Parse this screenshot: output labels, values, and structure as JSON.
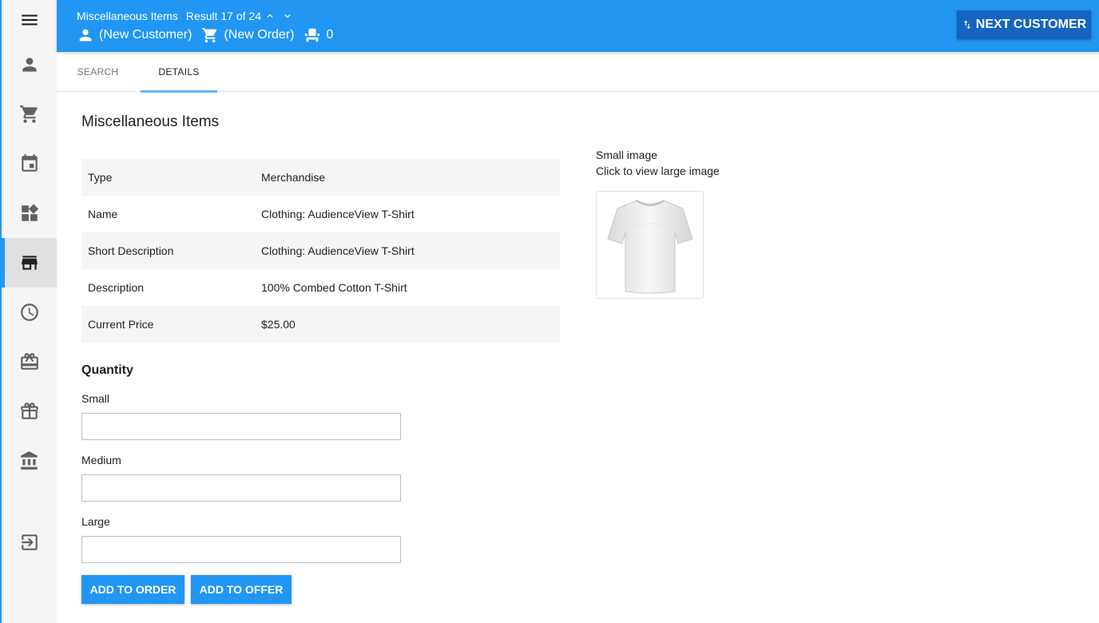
{
  "header": {
    "section": "Miscellaneous Items",
    "result": "Result 17 of 24",
    "customer": "(New Customer)",
    "order": "(New Order)",
    "seats": "0",
    "next_customer": "NEXT CUSTOMER",
    "color": "#2196f3"
  },
  "rail": {
    "items": [
      "person-icon",
      "cart-icon",
      "calendar-icon",
      "widgets-icon",
      "store-icon",
      "clock-icon",
      "ticket-icon",
      "gift-icon",
      "bank-icon",
      "exit-icon"
    ],
    "active": "store-icon"
  },
  "tabs": [
    {
      "label": "SEARCH"
    },
    {
      "label": "DETAILS",
      "active": true
    }
  ],
  "main": {
    "title": "Miscellaneous Items",
    "rows": [
      {
        "label": "Type",
        "value": "Merchandise"
      },
      {
        "label": "Name",
        "value": "Clothing: AudienceView T-Shirt"
      },
      {
        "label": "Short Description",
        "value": "Clothing: AudienceView T-Shirt"
      },
      {
        "label": "Description",
        "value": "100% Combed Cotton T-Shirt"
      },
      {
        "label": "Current Price",
        "value": "$25.00"
      }
    ],
    "quantity_title": "Quantity",
    "fields": [
      {
        "label": "Small",
        "value": ""
      },
      {
        "label": "Medium",
        "value": ""
      },
      {
        "label": "Large",
        "value": ""
      }
    ],
    "add_to_order": "ADD TO ORDER",
    "add_to_offer": "ADD TO OFFER"
  },
  "image": {
    "caption1": "Small image",
    "caption2": "Click to view large image"
  }
}
